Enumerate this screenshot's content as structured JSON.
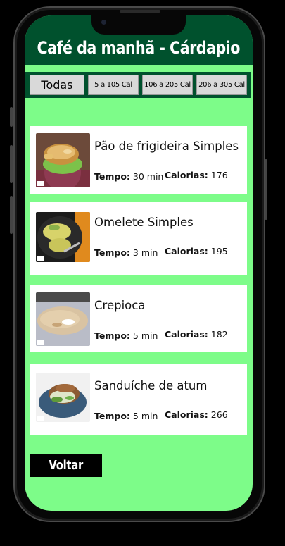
{
  "header": {
    "title": "Café da manhã - Cárdapio"
  },
  "filters": [
    {
      "label": "Todas"
    },
    {
      "label": "5 a 105 Cal"
    },
    {
      "label": "106 a 205 Cal"
    },
    {
      "label": "206 a 305 Cal"
    }
  ],
  "labels": {
    "time": "Tempo:",
    "calories": "Calorias:"
  },
  "recipes": [
    {
      "name": "Pão de frigideira Simples",
      "time": "30 min",
      "calories": "176",
      "image_icon": "toasted-sandwich-photo"
    },
    {
      "name": "Omelete Simples",
      "time": "3 min",
      "calories": "195",
      "image_icon": "omelette-photo"
    },
    {
      "name": "Crepioca",
      "time": "5 min",
      "calories": "182",
      "image_icon": "crepioca-photo"
    },
    {
      "name": "Sanduíche de atum",
      "time": "5 min",
      "calories": "266",
      "image_icon": "tuna-sandwich-photo"
    }
  ],
  "footer": {
    "back_label": "Voltar"
  },
  "colors": {
    "header_bg": "#00512d",
    "screen_bg": "#7dfc89",
    "card_bg": "#ffffff",
    "button_bg": "#d9d9d9"
  }
}
